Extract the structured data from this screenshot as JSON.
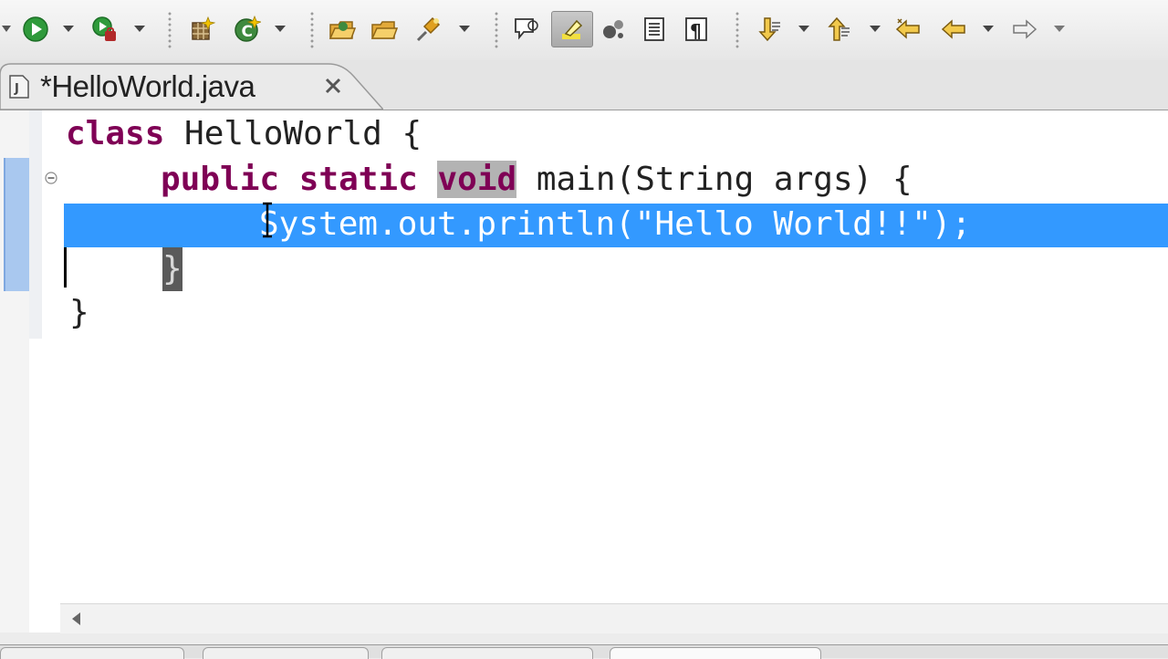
{
  "window": {
    "title": ""
  },
  "toolbar": {
    "groups": [
      [
        "run",
        "debug-run"
      ],
      [
        "new-class",
        "refresh-build"
      ],
      [
        "open-folder",
        "open-file",
        "pin-tool"
      ],
      [
        "toggle-comment",
        "mark-occurrences",
        "toggle-breadcrumbs",
        "show-block",
        "show-whitespace"
      ],
      [
        "next-annotation",
        "previous-annotation",
        "last-edit",
        "back",
        "forward"
      ]
    ]
  },
  "editor": {
    "tab_title": "*HelloWorld.java",
    "tab_icon": "java-file-icon",
    "code": {
      "line1": {
        "kw": "class",
        "rest": " HelloWorld {"
      },
      "line2": {
        "kw1": "public",
        "kw2": "static",
        "kw3": "void",
        "rest": " main(String args) {"
      },
      "line3": "System.out.println(\"Hello World!!\");",
      "line4": "}",
      "line5": "}"
    },
    "selected_line": 3,
    "caret_line": 4
  },
  "colors": {
    "keyword": "#7f0055",
    "selection": "#3399ff",
    "occurrence_highlight": "#b3b3b3",
    "overview_ruler_mark": "#a9c8ef"
  }
}
